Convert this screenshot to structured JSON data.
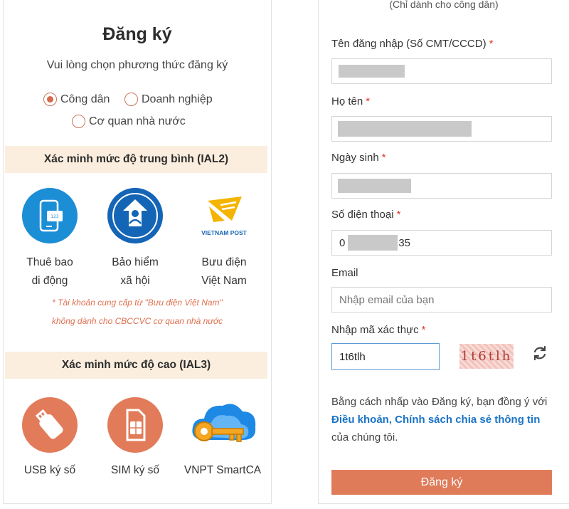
{
  "left": {
    "title": "Đăng ký",
    "subtitle": "Vui lòng chọn phương thức đăng ký",
    "account_types": [
      {
        "label": "Công dân",
        "checked": true
      },
      {
        "label": "Doanh nghiệp",
        "checked": false
      },
      {
        "label": "Cơ quan nhà nước",
        "checked": false
      }
    ],
    "ial2": {
      "heading": "Xác minh mức độ trung bình (IAL2)",
      "methods": [
        {
          "label_line1": "Thuê bao",
          "label_line2": "di động",
          "icon": "mobile-subscription-icon"
        },
        {
          "label_line1": "Bảo hiểm",
          "label_line2": "xã hội",
          "icon": "social-insurance-icon"
        },
        {
          "label_line1": "Bưu điện",
          "label_line2": "Việt Nam",
          "icon": "vietnam-post-icon",
          "logo_text": "VIETNAM POST"
        }
      ],
      "note_line1": "* Tài khoản cung cấp từ \"Bưu điện Việt Nam\"",
      "note_line2": "không dành cho CBCCVC cơ quan nhà nước"
    },
    "ial3": {
      "heading": "Xác minh mức độ cao (IAL3)",
      "methods": [
        {
          "label": "USB ký số",
          "icon": "usb-token-icon"
        },
        {
          "label": "SIM ký số",
          "icon": "sim-card-icon"
        },
        {
          "label": "VNPT SmartCA",
          "icon": "smartca-key-icon"
        }
      ]
    }
  },
  "form": {
    "top_note": "(Chỉ dành cho công dân)",
    "fields": {
      "username": {
        "label": "Tên đăng nhập (Số CMT/CCCD)",
        "required_mark": "*"
      },
      "fullname": {
        "label": "Họ tên",
        "required_mark": "*"
      },
      "dob": {
        "label": "Ngày sinh",
        "required_mark": "*"
      },
      "phone": {
        "label": "Số điện thoại",
        "required_mark": "*",
        "prefix": "0",
        "suffix": "35"
      },
      "email": {
        "label": "Email",
        "placeholder": "Nhập email của bạn"
      },
      "captcha": {
        "label": "Nhập mã xác thực",
        "required_mark": "*",
        "value": "1t6tlh",
        "image_text": "1t6tlh"
      }
    },
    "terms": {
      "before": "Bằng cách nhấp vào Đăng ký, bạn đồng ý với ",
      "link": "Điều khoản, Chính sách chia sẻ thông tin",
      "after": " của chúng tôi."
    },
    "submit_label": "Đăng ký"
  },
  "colors": {
    "accent": "#e07b5a",
    "band": "#fbeede",
    "link": "#1a73c7",
    "required": "#e23a2a"
  }
}
